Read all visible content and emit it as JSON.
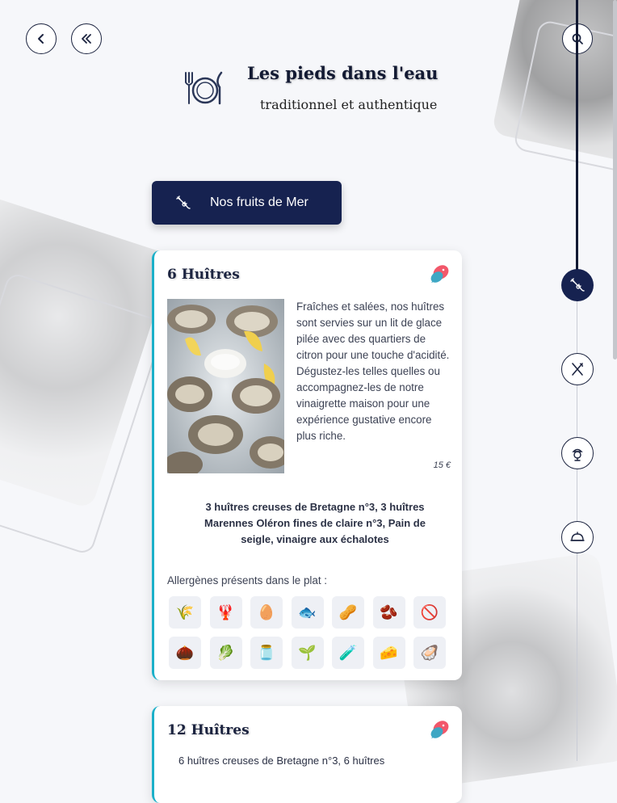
{
  "restaurant": {
    "name": "Les pieds dans l'eau",
    "tagline": "traditionnel et authentique"
  },
  "nav": {
    "back_icon": "chevron-left-icon",
    "home_icon": "double-chevron-left-icon",
    "search_icon": "search-icon"
  },
  "category": {
    "label": "Nos fruits de Mer",
    "icon": "lobster-icon"
  },
  "dishes": [
    {
      "title": "6 Huîtres",
      "badge_icon": "fish-icon",
      "description": "Fraîches et salées, nos huîtres sont servies sur un lit de glace pilée avec des quartiers de citron pour une touche d'acidité. Dégustez-les telles quelles ou accompagnez-les de notre vinaigrette maison pour une expérience gustative encore plus riche.",
      "price": "15 €",
      "composition": "3 huîtres creuses de Bretagne n°3, 3 huîtres Marennes Oléron fines de claire n°3, Pain de seigle, vinaigre aux échalotes",
      "allergen_title": "Allergènes présents dans le plat :",
      "allergens": [
        {
          "icon": "gluten-icon",
          "glyph": "🌾"
        },
        {
          "icon": "crustacean-icon",
          "glyph": "🦞"
        },
        {
          "icon": "egg-icon",
          "glyph": "🥚"
        },
        {
          "icon": "fish-icon",
          "glyph": "🐟"
        },
        {
          "icon": "peanut-icon",
          "glyph": "🥜"
        },
        {
          "icon": "soy-icon",
          "glyph": "🫘"
        },
        {
          "icon": "sulfite-icon",
          "glyph": "🚫"
        },
        {
          "icon": "nut-icon",
          "glyph": "🌰"
        },
        {
          "icon": "celery-icon",
          "glyph": "🥬"
        },
        {
          "icon": "mustard-icon",
          "glyph": "🫙"
        },
        {
          "icon": "sesame-icon",
          "glyph": "🌱"
        },
        {
          "icon": "lupin-icon",
          "glyph": "🧪"
        },
        {
          "icon": "milk-icon",
          "glyph": "🧀"
        },
        {
          "icon": "mollusc-icon",
          "glyph": "🦪"
        }
      ]
    },
    {
      "title": "12 Huîtres",
      "badge_icon": "fish-icon",
      "composition_partial": "6 huîtres creuses de Bretagne n°3, 6 huîtres"
    }
  ],
  "timeline": [
    {
      "icon": "lobster-icon",
      "active": true
    },
    {
      "icon": "fork-knife-icon",
      "active": false
    },
    {
      "icon": "dessert-icon",
      "active": false
    },
    {
      "icon": "cloche-icon",
      "active": false
    }
  ],
  "colors": {
    "primary": "#162250",
    "accent": "#1bb0c9",
    "background": "#f6f7fa"
  }
}
